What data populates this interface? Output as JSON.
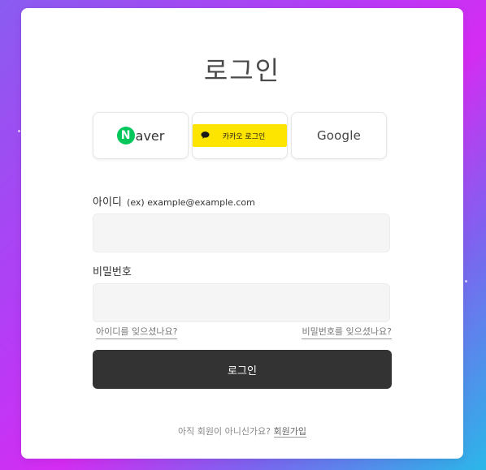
{
  "page": {
    "title": "로그인"
  },
  "social": {
    "naver": {
      "letter": "N",
      "text": "aver"
    },
    "kakao": {
      "label": "카카오 로그인"
    },
    "google": {
      "label": "Google"
    }
  },
  "form": {
    "id_label": "아이디",
    "id_hint": "(ex) example@example.com",
    "id_value": "",
    "password_label": "비밀번호",
    "password_value": "",
    "forgot_id": "아이디를 잊으셨나요?",
    "forgot_password": "비밀번호를 잊으셨나요?",
    "submit_label": "로그인"
  },
  "footer": {
    "prompt": "아직 회원이 아니신가요?",
    "signup_label": "회원가입"
  },
  "colors": {
    "naver_green": "#03c75a",
    "kakao_yellow": "#fee500",
    "button_dark": "#333333"
  }
}
